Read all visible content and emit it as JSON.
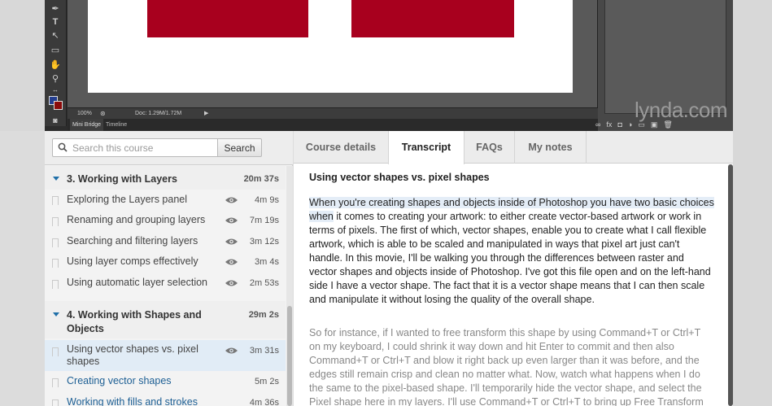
{
  "video": {
    "zoom": "100%",
    "doc_info": "Doc: 1.29M/1.72M",
    "bottom_tabs": [
      "Mini Bridge",
      "Timeline"
    ],
    "logo": "lynda.com",
    "colors": {
      "shape_red": "#a8001e",
      "foreground": "#243e8f",
      "background": "#8b0a0a"
    }
  },
  "search": {
    "placeholder": "Search this course",
    "value": "",
    "button_label": "Search"
  },
  "toc": {
    "chapters": [
      {
        "title": "3. Working with Layers",
        "duration": "20m 37s",
        "movies": [
          {
            "title": "Exploring the Layers panel",
            "duration": "4m 9s",
            "viewed": true
          },
          {
            "title": "Renaming and grouping layers",
            "duration": "7m 19s",
            "viewed": true
          },
          {
            "title": "Searching and filtering layers",
            "duration": "3m 12s",
            "viewed": true
          },
          {
            "title": "Using layer comps effectively",
            "duration": "3m 4s",
            "viewed": true
          },
          {
            "title": "Using automatic layer selection",
            "duration": "2m 53s",
            "viewed": true
          }
        ]
      },
      {
        "title": "4. Working with Shapes and Objects",
        "duration": "29m 2s",
        "movies": [
          {
            "title": "Using vector shapes vs. pixel shapes",
            "duration": "3m 31s",
            "viewed": true,
            "active": true
          },
          {
            "title": "Creating vector shapes",
            "duration": "5m 2s",
            "viewed": false
          },
          {
            "title": "Working with fills and strokes",
            "duration": "4m 36s",
            "viewed": false
          }
        ]
      }
    ]
  },
  "tabs": [
    {
      "label": "Course details",
      "active": false
    },
    {
      "label": "Transcript",
      "active": true
    },
    {
      "label": "FAQs",
      "active": false
    },
    {
      "label": "My notes",
      "active": false
    }
  ],
  "transcript": {
    "title": "Using vector shapes vs. pixel shapes",
    "para1_highlight": "When you're creating shapes and objects inside of Photoshop you have two basic choices when",
    "para1_rest": " it comes to creating your artwork: to either create vector-based artwork or work in terms of pixels. The first of which, vector shapes, enable you to create what I call flexible artwork, which is able to be scaled and manipulated in ways that pixel art just can't handle. In this movie, I'll be walking you through the differences between raster and vector shapes and objects inside of Photoshop. I've got this file open and on the left-hand side I have a vector shape. The fact that it is a vector shape means that I can then scale and manipulate it without losing the quality of the overall shape.",
    "para2": "So for instance, if I wanted to free transform this shape by using Command+T or Ctrl+T on my keyboard, I could shrink it way down and hit Enter to commit and then also Command+T or Ctrl+T and blow it right back up even larger than it was before, and the edges still remain crisp and clean no matter what. Now, watch what happens when I do the same to the pixel-based shape. I'll temporarily hide the vector shape, and select the Pixel shape here in my layers. I'll use Command+T or Ctrl+T to bring up Free Transform and then I'll shrink this"
  }
}
